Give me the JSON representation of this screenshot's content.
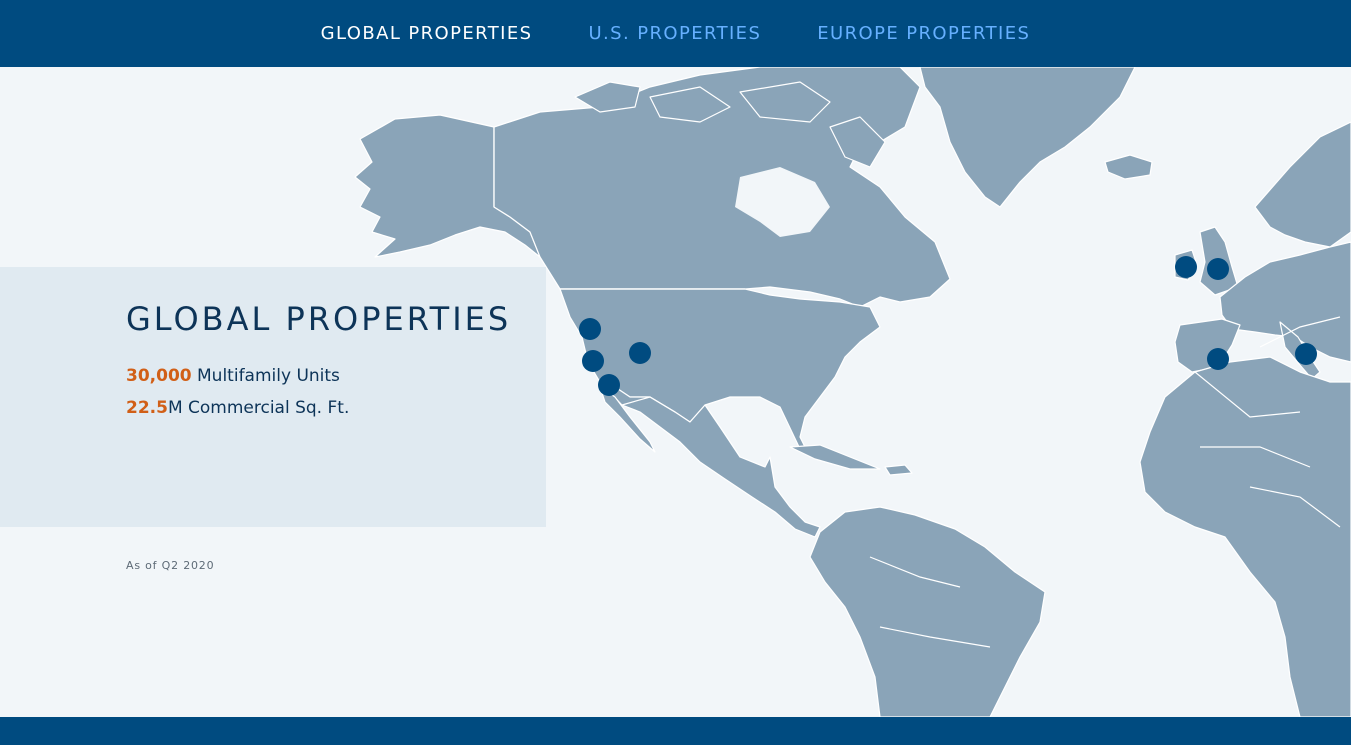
{
  "nav": {
    "items": [
      {
        "label": "GLOBAL PROPERTIES",
        "active": true
      },
      {
        "label": "U.S. PROPERTIES",
        "active": false
      },
      {
        "label": "EUROPE PROPERTIES",
        "active": false
      }
    ]
  },
  "panel": {
    "title": "GLOBAL PROPERTIES",
    "stat1_value": "30,000",
    "stat1_label": " Multifamily Units",
    "stat2_value": "22.5",
    "stat2_label": "M Commercial Sq. Ft."
  },
  "asof": "As of Q2 2020",
  "colors": {
    "nav_bg": "#004b80",
    "land": "#8aa4b8",
    "ocean": "#f2f6f9",
    "marker": "#004b80",
    "accent_number": "#d15f17",
    "nav_inactive": "#66b0ff"
  },
  "map": {
    "markers": [
      {
        "name": "marker-us-northern-california"
      },
      {
        "name": "marker-us-central-california"
      },
      {
        "name": "marker-us-southern-california"
      },
      {
        "name": "marker-us-utah"
      },
      {
        "name": "marker-ireland"
      },
      {
        "name": "marker-united-kingdom"
      },
      {
        "name": "marker-spain"
      },
      {
        "name": "marker-italy"
      }
    ]
  }
}
